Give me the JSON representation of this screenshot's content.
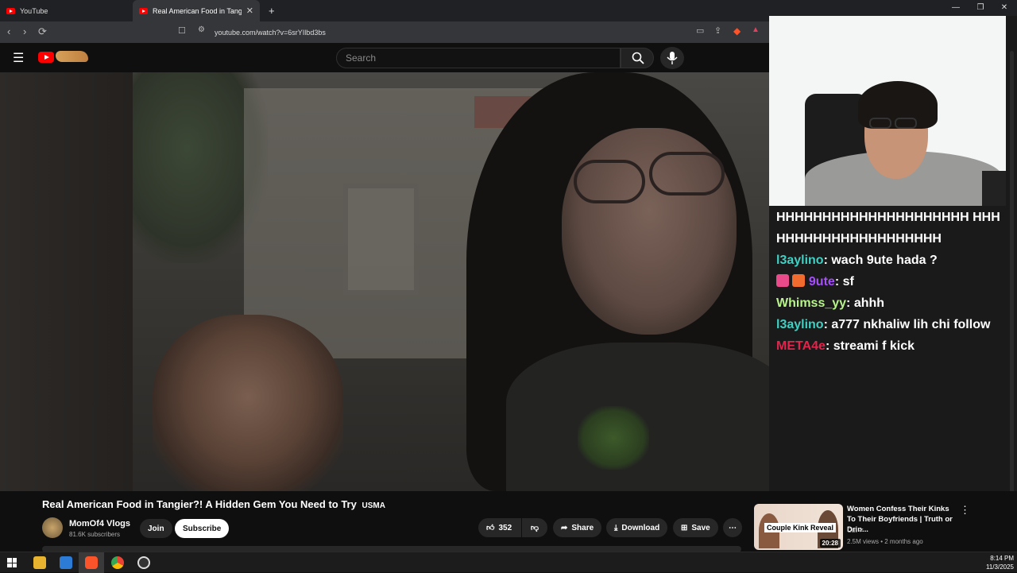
{
  "browser": {
    "tabs": [
      {
        "label": "YouTube"
      },
      {
        "label": "Real American Food in Tangier?!"
      }
    ],
    "url": "youtube.com/watch?v=6srYIlbd3bs",
    "new_tab_label": "+"
  },
  "youtube": {
    "search_placeholder": "Search"
  },
  "chat": {
    "messages": [
      {
        "user": "",
        "text": "HHHHHHHHHHHHHHHHHHHHH HHHHHHHHHHHHHHHHHHHHH",
        "color": "#ffffff"
      },
      {
        "user": "l3aylino",
        "text": "wach 9ute hada ?",
        "color": "#3fd0c4"
      },
      {
        "user": "9ute",
        "text": "sf",
        "color": "#a64dff"
      },
      {
        "user": "Whimss_yy",
        "text": "ahhh",
        "color": "#b7f48a"
      },
      {
        "user": "l3aylino",
        "text": "a777 nkhaliw lih chi follow",
        "color": "#3fd0c4"
      },
      {
        "user": "META4e",
        "text": "streami f kick",
        "color": "#e3244c"
      }
    ]
  },
  "video": {
    "title": "Real American Food in Tangier?! A Hidden Gem You Need to Try",
    "title_badge": "USMA",
    "channel": "MomOf4 Vlogs",
    "subscribers": "81.6K subscribers",
    "join_label": "Join",
    "subscribe_label": "Subscribe",
    "likes": "352",
    "share_label": "Share",
    "download_label": "Download",
    "save_label": "Save"
  },
  "recommendation": {
    "title": "Women Confess Their Kinks To Their Boyfriends | Truth or Drin...",
    "thumb_text": "Couple Kink Reveal",
    "duration": "20:28",
    "channel": "Cut",
    "meta": "2.5M views • 2 months ago"
  },
  "taskbar": {
    "time": "8:14 PM",
    "date": "11/3/2025"
  },
  "colors": {
    "accent_red": "#ff0000",
    "subscribe_bg": "#ffffff"
  }
}
